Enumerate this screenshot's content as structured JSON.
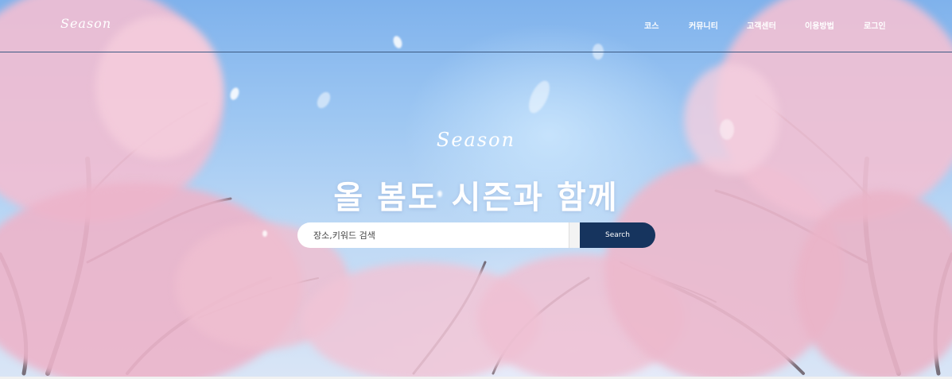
{
  "header": {
    "logo": "Season",
    "nav": [
      {
        "label": "코스"
      },
      {
        "label": "커뮤니티"
      },
      {
        "label": "고객센터"
      },
      {
        "label": "이용방법"
      },
      {
        "label": "로그인"
      }
    ]
  },
  "hero": {
    "logo": "Season",
    "headline": "올 봄도 시즌과 함께",
    "search": {
      "placeholder": "장소,키워드 검색",
      "value": "",
      "button_label": "Search"
    },
    "background": "cherry-blossom-trees-under-blue-sky"
  },
  "colors": {
    "sky": "#9cc6f2",
    "blossom": "#f1c6d6",
    "search_button": "#16345e",
    "nav_line": "#3c5a83"
  }
}
